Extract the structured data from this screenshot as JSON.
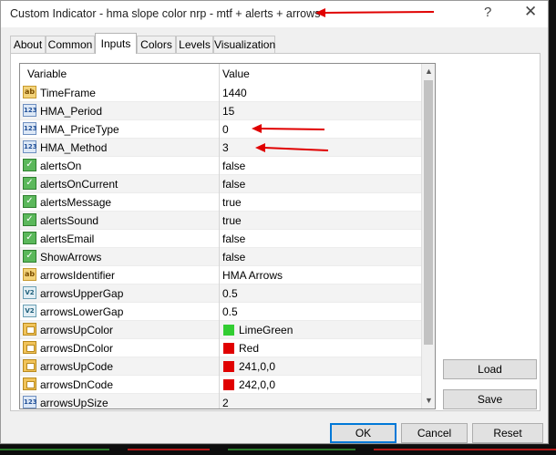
{
  "window": {
    "title": "Custom Indicator - hma slope color nrp - mtf + alerts + arrows",
    "help_glyph": "?",
    "close_glyph": "✕"
  },
  "tabs": [
    {
      "label": "About",
      "active": false
    },
    {
      "label": "Common",
      "active": false
    },
    {
      "label": "Inputs",
      "active": true
    },
    {
      "label": "Colors",
      "active": false
    },
    {
      "label": "Levels",
      "active": false
    },
    {
      "label": "Visualization",
      "active": false
    }
  ],
  "grid": {
    "headers": {
      "variable": "Variable",
      "value": "Value"
    },
    "rows": [
      {
        "type": "ab",
        "icon": "ab-string-icon",
        "name": "TimeFrame",
        "value": "1440"
      },
      {
        "type": "num",
        "icon": "integer-icon",
        "name": "HMA_Period",
        "value": "15"
      },
      {
        "type": "num",
        "icon": "integer-icon",
        "name": "HMA_PriceType",
        "value": "0"
      },
      {
        "type": "num",
        "icon": "integer-icon",
        "name": "HMA_Method",
        "value": "3"
      },
      {
        "type": "bool",
        "icon": "boolean-icon",
        "name": "alertsOn",
        "value": "false"
      },
      {
        "type": "bool",
        "icon": "boolean-icon",
        "name": "alertsOnCurrent",
        "value": "false"
      },
      {
        "type": "bool",
        "icon": "boolean-icon",
        "name": "alertsMessage",
        "value": "true"
      },
      {
        "type": "bool",
        "icon": "boolean-icon",
        "name": "alertsSound",
        "value": "true"
      },
      {
        "type": "bool",
        "icon": "boolean-icon",
        "name": "alertsEmail",
        "value": "false"
      },
      {
        "type": "bool",
        "icon": "boolean-icon",
        "name": "ShowArrows",
        "value": "false"
      },
      {
        "type": "ab",
        "icon": "ab-string-icon",
        "name": "arrowsIdentifier",
        "value": "HMA Arrows"
      },
      {
        "type": "dbl",
        "icon": "double-icon",
        "name": "arrowsUpperGap",
        "value": "0.5"
      },
      {
        "type": "dbl",
        "icon": "double-icon",
        "name": "arrowsLowerGap",
        "value": "0.5"
      },
      {
        "type": "col",
        "icon": "color-icon",
        "name": "arrowsUpColor",
        "value": "LimeGreen",
        "swatch": "#32cd32"
      },
      {
        "type": "col",
        "icon": "color-icon",
        "name": "arrowsDnColor",
        "value": "Red",
        "swatch": "#e00000"
      },
      {
        "type": "col",
        "icon": "color-icon",
        "name": "arrowsUpCode",
        "value": "241,0,0",
        "swatch": "#e00000"
      },
      {
        "type": "col",
        "icon": "color-icon",
        "name": "arrowsDnCode",
        "value": "242,0,0",
        "swatch": "#e00000"
      },
      {
        "type": "num",
        "icon": "integer-icon",
        "name": "arrowsUpSize",
        "value": "2"
      }
    ]
  },
  "icon_glyphs": {
    "ab": "ab",
    "num": "123",
    "bool": "✓",
    "dbl": "V2",
    "col": ""
  },
  "buttons": {
    "load": "Load",
    "save": "Save",
    "ok": "OK",
    "cancel": "Cancel",
    "reset": "Reset"
  },
  "colors": {
    "annotation_red": "#e00000",
    "accent_blue": "#0078d7"
  }
}
